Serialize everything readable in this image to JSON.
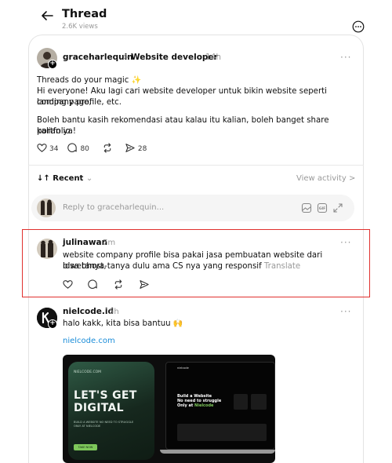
{
  "header": {
    "title": "Thread",
    "views": "2.6K views"
  },
  "post": {
    "author": "graceharlequin",
    "separator": ">",
    "topic": "Website developer",
    "time": "14h",
    "line1": "Threads do your magic ✨",
    "line2": "Hi everyone! Aku lagi cari website developer untuk bikin website seperti landing page,",
    "line3": "company profile, etc.",
    "line4": "Boleh bantu kasih rekomendasi atau kalau itu kalian, boleh banget share portfolio",
    "line5": "kalian ya!",
    "likes": "34",
    "replies": "80",
    "reposts": "",
    "shares": "28"
  },
  "filter": {
    "label": "Recent",
    "arrows": "↓↑",
    "view_activity": "View activity >"
  },
  "reply_box": {
    "placeholder": "Reply to graceharlequin..."
  },
  "comments": [
    {
      "author": "julinawan",
      "time": "7m",
      "line1": "website company profile bisa pakai jasa pembuatan website dari idwebhost,",
      "line2": "bisa tanya-tanya dulu ama CS nya yang responsif",
      "translate": "Translate"
    },
    {
      "author": "nielcode.id",
      "time": "5h",
      "line1": "halo kakk, kita bisa bantuu 🙌",
      "link": "nielcode.com"
    }
  ],
  "promo": {
    "small": "NIELCODE.COM",
    "big1": "LET'S GET",
    "big2": "DIGITAL",
    "sub": "BUILD A WEBSITE NO NEED TO STRUGGLE ONLY AT NIELCODE",
    "button": "TAKE NOW",
    "laptop_nav": "nielcode",
    "laptop_head1": "Build a Website",
    "laptop_head2": "No need to struggle",
    "laptop_head3": "Only at",
    "laptop_accent": "Nielcode"
  },
  "colors": {
    "highlight": "#e0302e",
    "link": "#1a8cd8",
    "muted": "#999999",
    "accent_green": "#7ec85b"
  },
  "icons": [
    "back-arrow-icon",
    "more-circle-icon",
    "heart-icon",
    "comment-icon",
    "repost-icon",
    "share-icon",
    "image-icon",
    "gif-icon",
    "expand-icon",
    "more-dots-icon",
    "plus-badge-icon"
  ]
}
